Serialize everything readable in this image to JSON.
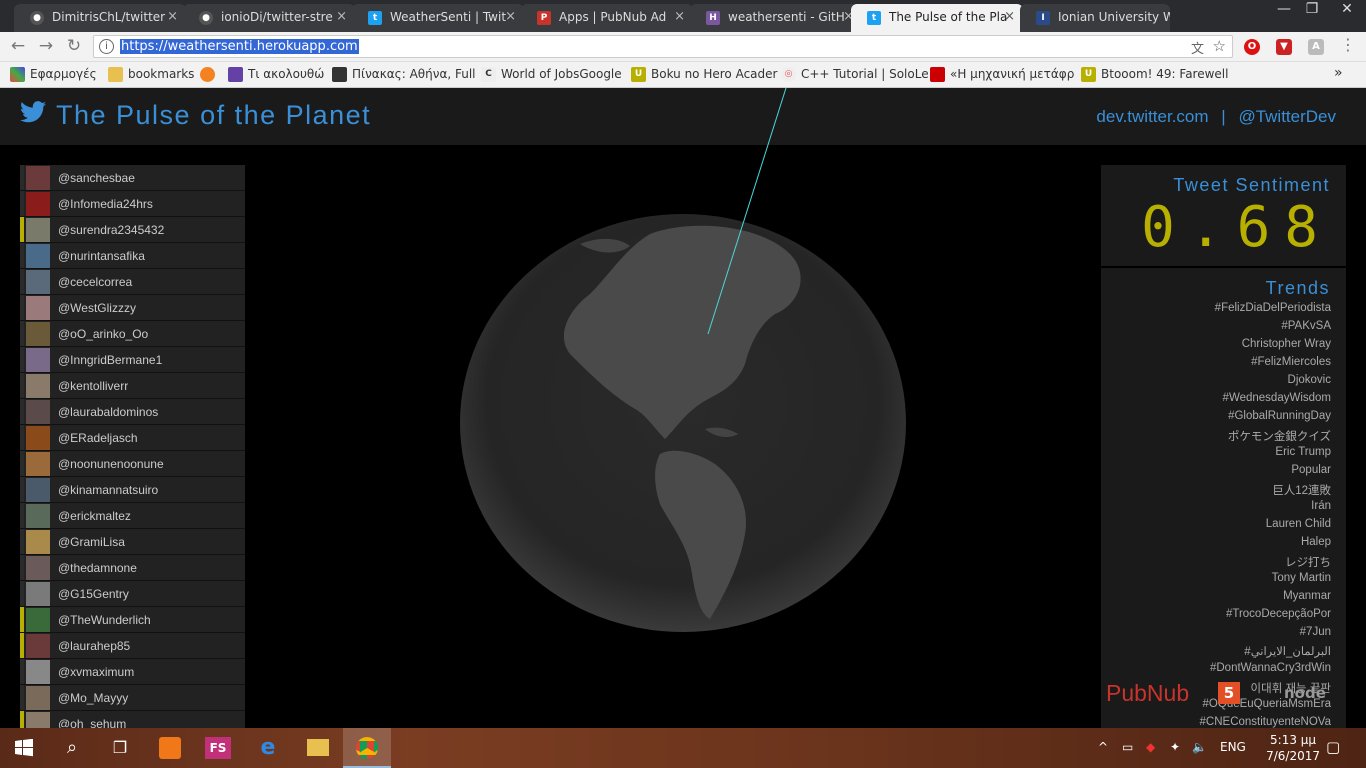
{
  "browser": {
    "tabs": [
      {
        "title": "DimitrisChL/twitter",
        "icon": "github-icon"
      },
      {
        "title": "ionioDi/twitter-stre",
        "icon": "github-icon"
      },
      {
        "title": "WeatherSenti | Twit",
        "icon": "twitter-icon"
      },
      {
        "title": "Apps | PubNub Ad",
        "icon": "pubnub-icon"
      },
      {
        "title": "weathersenti - GitH",
        "icon": "heroku-icon"
      },
      {
        "title": "The Pulse of the Pla",
        "icon": "twitter-icon",
        "active": true
      },
      {
        "title": "Ionian University W",
        "icon": "university-icon"
      }
    ],
    "url": "https://weathersenti.herokuapp.com",
    "bookmarks": [
      "Εφαρμογές",
      "bookmarks",
      "",
      "Τι ακολουθώ",
      "Πίνακας: Αθήνα, Full",
      "World of JobsGoogle",
      "Boku no Hero Acader",
      "C++ Tutorial | SoloLe",
      "«Η μηχανική μετάφρ",
      "Btooom! 49: Farewell"
    ],
    "more": "»"
  },
  "header": {
    "title": "The Pulse of the Planet",
    "link1": "dev.twitter.com",
    "separator": "|",
    "link2": "@TwitterDev"
  },
  "users": [
    {
      "name": "@sanchesbae",
      "mark": false
    },
    {
      "name": "@Infomedia24hrs",
      "mark": false
    },
    {
      "name": "@surendra2345432",
      "mark": true
    },
    {
      "name": "@nurintansafika",
      "mark": false
    },
    {
      "name": "@cecelcorrea",
      "mark": false
    },
    {
      "name": "@WestGlizzzy",
      "mark": false
    },
    {
      "name": "@oO_arinko_Oo",
      "mark": false
    },
    {
      "name": "@InngridBermane1",
      "mark": false
    },
    {
      "name": "@kentolliverr",
      "mark": false
    },
    {
      "name": "@laurabaldominos",
      "mark": false
    },
    {
      "name": "@ERadeljasch",
      "mark": false
    },
    {
      "name": "@noonunenoonune",
      "mark": false
    },
    {
      "name": "@kinamannatsuiro",
      "mark": false
    },
    {
      "name": "@erickmaltez",
      "mark": false
    },
    {
      "name": "@GramiLisa",
      "mark": false
    },
    {
      "name": "@thedamnone",
      "mark": false
    },
    {
      "name": "@G15Gentry",
      "mark": false
    },
    {
      "name": "@TheWunderlich",
      "mark": true
    },
    {
      "name": "@laurahep85",
      "mark": true
    },
    {
      "name": "@xvmaximum",
      "mark": false
    },
    {
      "name": "@Mo_Mayyy",
      "mark": false
    },
    {
      "name": "@oh_sehum",
      "mark": true
    }
  ],
  "sentiment": {
    "label": "Tweet Sentiment",
    "value": "0.68"
  },
  "trends": {
    "label": "Trends",
    "items": [
      "#FelizDiaDelPeriodista",
      "#PAKvSA",
      "Christopher Wray",
      "#FelizMiercoles",
      "Djokovic",
      "#WednesdayWisdom",
      "#GlobalRunningDay",
      "ポケモン金銀クイズ",
      "Eric Trump",
      "Popular",
      "巨人12連敗",
      "Irán",
      "Lauren Child",
      "Halep",
      "レジ打ち",
      "Tony Martin",
      "Myanmar",
      "#TrocoDecepçãoPor",
      "#7Jun",
      "#البرلمان_الايراني",
      "#DontWannaCry3rdWin",
      "이대휘 재능 끝판",
      "#OQueEuQueriaMsmEra",
      "#CNEConstituyenteNOVa"
    ]
  },
  "powered": {
    "pubnub": "PubNub",
    "html5": "5",
    "node": "node"
  },
  "taskbar": {
    "lang": "ENG",
    "time": "5:13 μμ",
    "date": "7/6/2017"
  },
  "colors": {
    "accent": "#3a8fd6",
    "sentiment": "#b8b000",
    "pubnub": "#c8342b"
  }
}
